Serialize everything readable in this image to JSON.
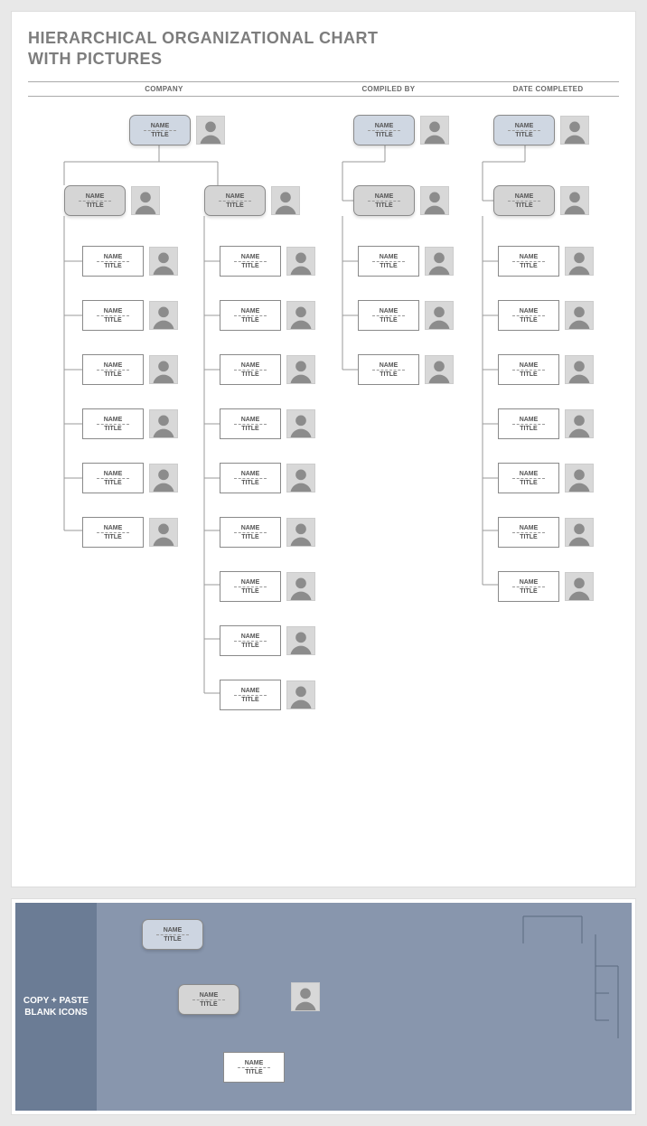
{
  "title_line1": "HIERARCHICAL ORGANIZATIONAL CHART",
  "title_line2": "WITH PICTURES",
  "headers": {
    "company": "COMPANY",
    "compiled": "COMPILED BY",
    "date": "DATE COMPLETED"
  },
  "labels": {
    "name": "NAME",
    "title": "TITLE"
  },
  "panel": {
    "side_line1": "COPY + PASTE",
    "side_line2": "BLANK ICONS"
  },
  "chart_data": {
    "type": "tree",
    "description": "Blank org-chart template: 4 parallel branches. Columns 1 and 2 share a top blue node that splits into two grey managers; column 1 manager has 6 white children, column 2 manager has 9. Columns 3 and 4 each have a blue top node, a grey manager below it, then 3 and 7 white children respectively. All cards read NAME / TITLE with avatar placeholder.",
    "columns": [
      {
        "shared_top_with_next": true,
        "top_style": "blue",
        "manager_style": "grey",
        "children": 6
      },
      {
        "shared_top_with_prev": true,
        "manager_style": "grey",
        "children": 9
      },
      {
        "top_style": "blue",
        "manager_style": "grey",
        "children": 3
      },
      {
        "top_style": "blue",
        "manager_style": "grey",
        "children": 7
      }
    ]
  }
}
